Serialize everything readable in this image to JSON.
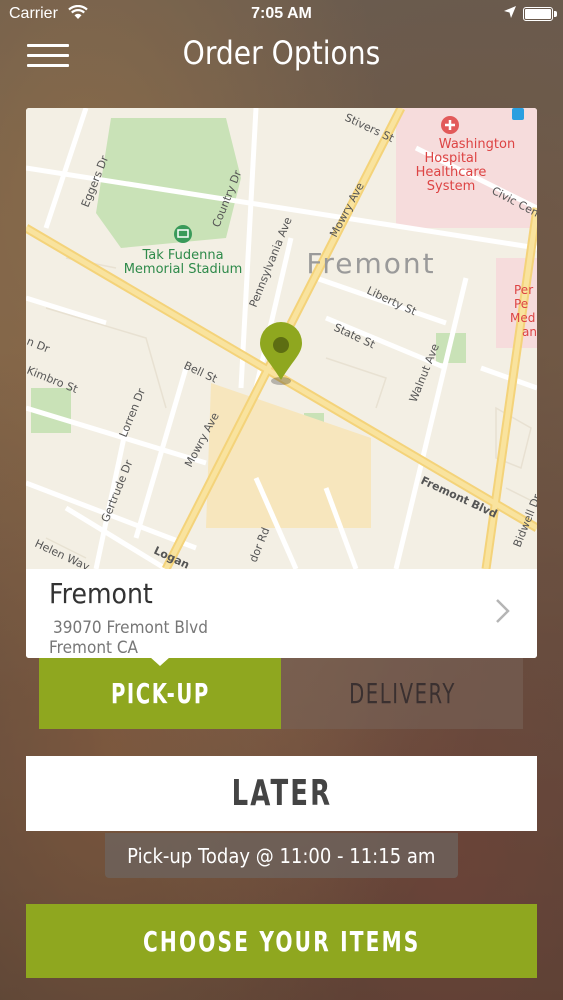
{
  "status_bar": {
    "carrier": "Carrier",
    "time": "7:05 AM"
  },
  "header": {
    "title": "Order Options",
    "menu_icon": "hamburger-menu-icon"
  },
  "map": {
    "labels": {
      "washington_hospital": [
        "Washington",
        "Hospital",
        "Healthcare",
        "System"
      ],
      "stadium": [
        "Tak Fudenna",
        "Memorial Stadium"
      ],
      "city": "Fremont",
      "streets": {
        "stivers": "Stivers St",
        "eggers": "Eggers Dr",
        "country": "Country Dr",
        "pennsylvania": "Pennsylvania Ave",
        "mowry_top": "Mowry Ave",
        "liberty": "Liberty St",
        "state": "State St",
        "bell": "Bell St",
        "kimbro": "Kimbro St",
        "walnut": "Walnut Ave",
        "lorren": "Lorren Dr",
        "mowry_bottom": "Mowry Ave",
        "fremont_blvd": "Fremont Blvd",
        "gertrude": "Gertrude Dr",
        "helen": "Helen Way",
        "logan": "Logan",
        "bidwell": "Bidwell Dr",
        "civic": "Civic Cen",
        "dor": "dor Rd",
        "an": "n Dr"
      },
      "edge_right": [
        "Per",
        "Pe",
        "Med",
        "an"
      ]
    },
    "pin_color": "#8fa71f"
  },
  "store": {
    "name": "Fremont",
    "address_line1": "39070 Fremont Blvd",
    "address_line2": "Fremont CA"
  },
  "order_type": {
    "pickup_label": "PICK-UP",
    "delivery_label": "DELIVERY",
    "selected": "pickup"
  },
  "timing": {
    "later_label": "LATER",
    "pickup_time": "Pick-up Today @ 11:00 - 11:15 am"
  },
  "cta": {
    "label": "CHOOSE YOUR ITEMS"
  },
  "colors": {
    "accent": "#8fa71f"
  }
}
